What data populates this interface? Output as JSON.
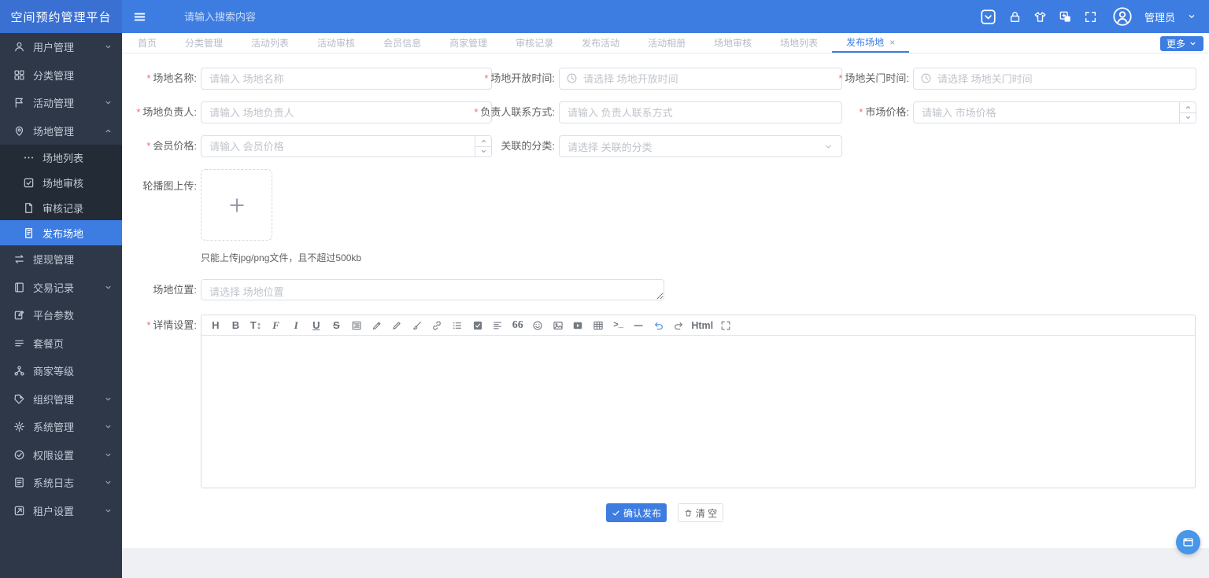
{
  "app": {
    "title": "空间预约管理平台"
  },
  "colors": {
    "accent": "#3d7de2",
    "logo_bg": "#3a70d2",
    "sidebar_bg": "#2e3849",
    "submenu_bg": "#232b37",
    "required_mark": "#f56c6c",
    "fab": "#4796e8",
    "page_bg": "#eef0f3"
  },
  "topbar": {
    "search_placeholder": "请输入搜索内容",
    "right_icons": [
      "panel-toggle",
      "lock",
      "theme-shirt",
      "copy-layers",
      "fullscreen"
    ],
    "user": "管理员"
  },
  "sidebar": {
    "items": [
      {
        "key": "user-management",
        "label": "用户管理",
        "icon": "user",
        "chevron": "down"
      },
      {
        "key": "category-management",
        "label": "分类管理",
        "icon": "grid"
      },
      {
        "key": "activity-management",
        "label": "活动管理",
        "icon": "flag",
        "chevron": "down"
      },
      {
        "key": "venue-management",
        "label": "场地管理",
        "icon": "pin",
        "chevron": "up",
        "children": [
          {
            "key": "venue-list",
            "label": "场地列表",
            "icon": "dots"
          },
          {
            "key": "venue-review",
            "label": "场地审核",
            "icon": "check-square"
          },
          {
            "key": "review-records",
            "label": "审核记录",
            "icon": "doc"
          },
          {
            "key": "publish-venue",
            "label": "发布场地",
            "icon": "promote",
            "active": true
          }
        ]
      },
      {
        "key": "withdrawal-management",
        "label": "提现管理",
        "icon": "transfer"
      },
      {
        "key": "transaction-records",
        "label": "交易记录",
        "icon": "book",
        "chevron": "down"
      },
      {
        "key": "platform-params",
        "label": "平台参数",
        "icon": "param"
      },
      {
        "key": "package-page",
        "label": "套餐页",
        "icon": "list"
      },
      {
        "key": "merchant-level",
        "label": "商家等级",
        "icon": "org"
      },
      {
        "key": "organization-management",
        "label": "组织管理",
        "icon": "tag",
        "chevron": "down"
      },
      {
        "key": "system-management",
        "label": "系统管理",
        "icon": "gear",
        "chevron": "down"
      },
      {
        "key": "permission-settings",
        "label": "权限设置",
        "icon": "check-circle",
        "chevron": "down"
      },
      {
        "key": "system-logs",
        "label": "系统日志",
        "icon": "log",
        "chevron": "down"
      },
      {
        "key": "tenant-settings",
        "label": "租户设置",
        "icon": "tenant",
        "chevron": "down"
      }
    ]
  },
  "tabs": {
    "items": [
      {
        "key": "home",
        "label": "首页"
      },
      {
        "key": "category-management",
        "label": "分类管理"
      },
      {
        "key": "activity-list",
        "label": "活动列表"
      },
      {
        "key": "activity-review",
        "label": "活动审核"
      },
      {
        "key": "member-info",
        "label": "会员信息"
      },
      {
        "key": "merchant-management",
        "label": "商家管理"
      },
      {
        "key": "review-records",
        "label": "审核记录"
      },
      {
        "key": "publish-activity",
        "label": "发布活动"
      },
      {
        "key": "activity-album",
        "label": "活动相册"
      },
      {
        "key": "venue-review",
        "label": "场地审核"
      },
      {
        "key": "venue-list",
        "label": "场地列表"
      },
      {
        "key": "publish-venue",
        "label": "发布场地",
        "active": true,
        "closable": true
      }
    ],
    "close_glyph": "×",
    "more_label": "更多"
  },
  "form": {
    "required_mark": "*",
    "fields": {
      "venue_name": {
        "label": "场地名称:",
        "required": true,
        "placeholder": "请输入 场地名称"
      },
      "open_time": {
        "label": "场地开放时间:",
        "required": true,
        "placeholder": "请选择 场地开放时间"
      },
      "close_time": {
        "label": "场地关门时间:",
        "required": true,
        "placeholder": "请选择 场地关门时间"
      },
      "manager": {
        "label": "场地负责人:",
        "required": true,
        "placeholder": "请输入 场地负责人"
      },
      "contact": {
        "label": "负责人联系方式:",
        "required": true,
        "placeholder": "请输入 负责人联系方式"
      },
      "market_price": {
        "label": "市场价格:",
        "required": true,
        "placeholder": "请输入 市场价格"
      },
      "member_price": {
        "label": "会员价格:",
        "required": true,
        "placeholder": "请输入 会员价格"
      },
      "category": {
        "label": "关联的分类:",
        "required": false,
        "placeholder": "请选择 关联的分类"
      },
      "carousel": {
        "label": "轮播图上传:",
        "required": false,
        "hint": "只能上传jpg/png文件，且不超过500kb"
      },
      "location": {
        "label": "场地位置:",
        "required": false,
        "placeholder": "请选择 场地位置"
      },
      "detail": {
        "label": "详情设置:",
        "required": true
      }
    },
    "editor": {
      "toolbar": [
        {
          "name": "heading-tool",
          "text": "H"
        },
        {
          "name": "bold-tool",
          "text": "B"
        },
        {
          "name": "font-size-tool",
          "text": "T↕"
        },
        {
          "name": "font-family-tool",
          "text": "F"
        },
        {
          "name": "italic-tool",
          "text": "I"
        },
        {
          "name": "underline-tool",
          "text": "U"
        },
        {
          "name": "strikethrough-tool",
          "text": "S"
        },
        {
          "name": "indent-tool",
          "icon": "indent"
        },
        {
          "name": "highlight-tool",
          "icon": "marker"
        },
        {
          "name": "pen-tool",
          "icon": "pen"
        },
        {
          "name": "brush-tool",
          "icon": "brush"
        },
        {
          "name": "link-tool",
          "icon": "link"
        },
        {
          "name": "bullet-list-tool",
          "icon": "ul"
        },
        {
          "name": "todo-list-tool",
          "icon": "todo"
        },
        {
          "name": "align-tool",
          "icon": "align"
        },
        {
          "name": "quote-tool",
          "text": "66"
        },
        {
          "name": "emoji-tool",
          "icon": "emoji"
        },
        {
          "name": "image-tool",
          "icon": "image"
        },
        {
          "name": "video-tool",
          "icon": "video"
        },
        {
          "name": "table-tool",
          "icon": "table"
        },
        {
          "name": "code-tool",
          "text": ">_"
        },
        {
          "name": "divider-tool",
          "icon": "hr"
        },
        {
          "name": "undo-tool",
          "icon": "undo"
        },
        {
          "name": "redo-tool",
          "icon": "redo"
        },
        {
          "name": "html-tool",
          "text": "Html"
        },
        {
          "name": "fullscreen-tool",
          "icon": "expand"
        }
      ]
    },
    "buttons": {
      "submit": "确认发布",
      "clear": "清 空"
    }
  }
}
